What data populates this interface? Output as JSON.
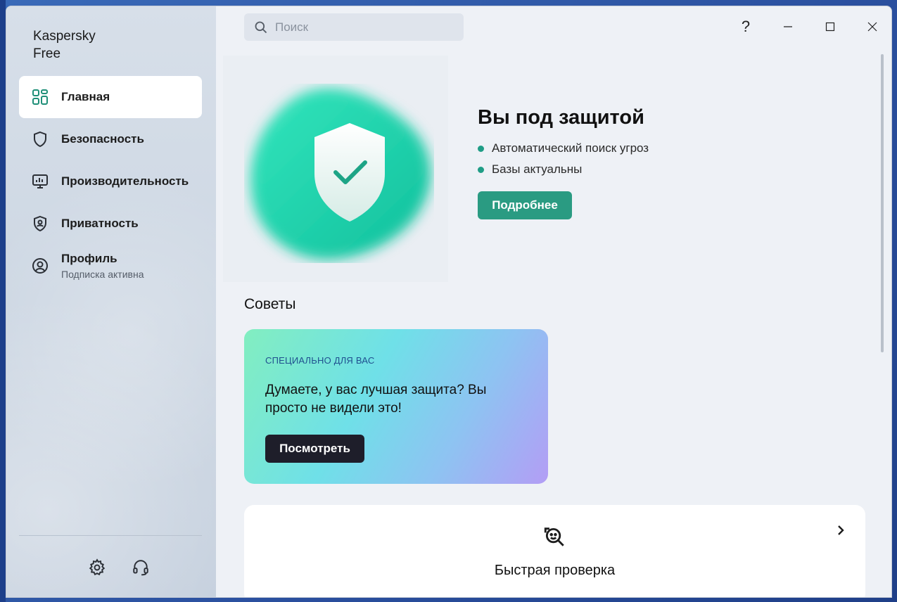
{
  "app": {
    "title": "Kaspersky\nFree"
  },
  "sidebar": {
    "items": [
      {
        "label": "Главная",
        "icon": "dashboard-grid-icon",
        "active": true
      },
      {
        "label": "Безопасность",
        "icon": "shield-icon",
        "active": false
      },
      {
        "label": "Производительность",
        "icon": "monitor-performance-icon",
        "active": false
      },
      {
        "label": "Приватность",
        "icon": "privacy-shield-icon",
        "active": false
      },
      {
        "label": "Профиль",
        "sublabel": "Подписка активна",
        "icon": "profile-icon",
        "active": false
      }
    ],
    "bottom": [
      {
        "icon": "gear-icon"
      },
      {
        "icon": "headset-icon"
      }
    ]
  },
  "search": {
    "placeholder": "Поиск"
  },
  "window_controls": {
    "help": "?",
    "minimize": "minimize-icon",
    "maximize": "maximize-icon",
    "close": "close-icon"
  },
  "status": {
    "title": "Вы под защитой",
    "items": [
      "Автоматический поиск угроз",
      "Базы актуальны"
    ],
    "button": "Подробнее"
  },
  "tips": {
    "title": "Советы",
    "promo": {
      "tag": "СПЕЦИАЛЬНО ДЛЯ ВАС",
      "text": "Думаете, у вас лучшая защита? Вы просто не видели это!",
      "button": "Посмотреть"
    }
  },
  "quick_scan": {
    "label": "Быстрая проверка",
    "icon": "scan-magnifier-icon"
  },
  "colors": {
    "accent": "#2a9b82",
    "promo_button": "#1e1e2a",
    "status_dot": "#1f9d86"
  }
}
